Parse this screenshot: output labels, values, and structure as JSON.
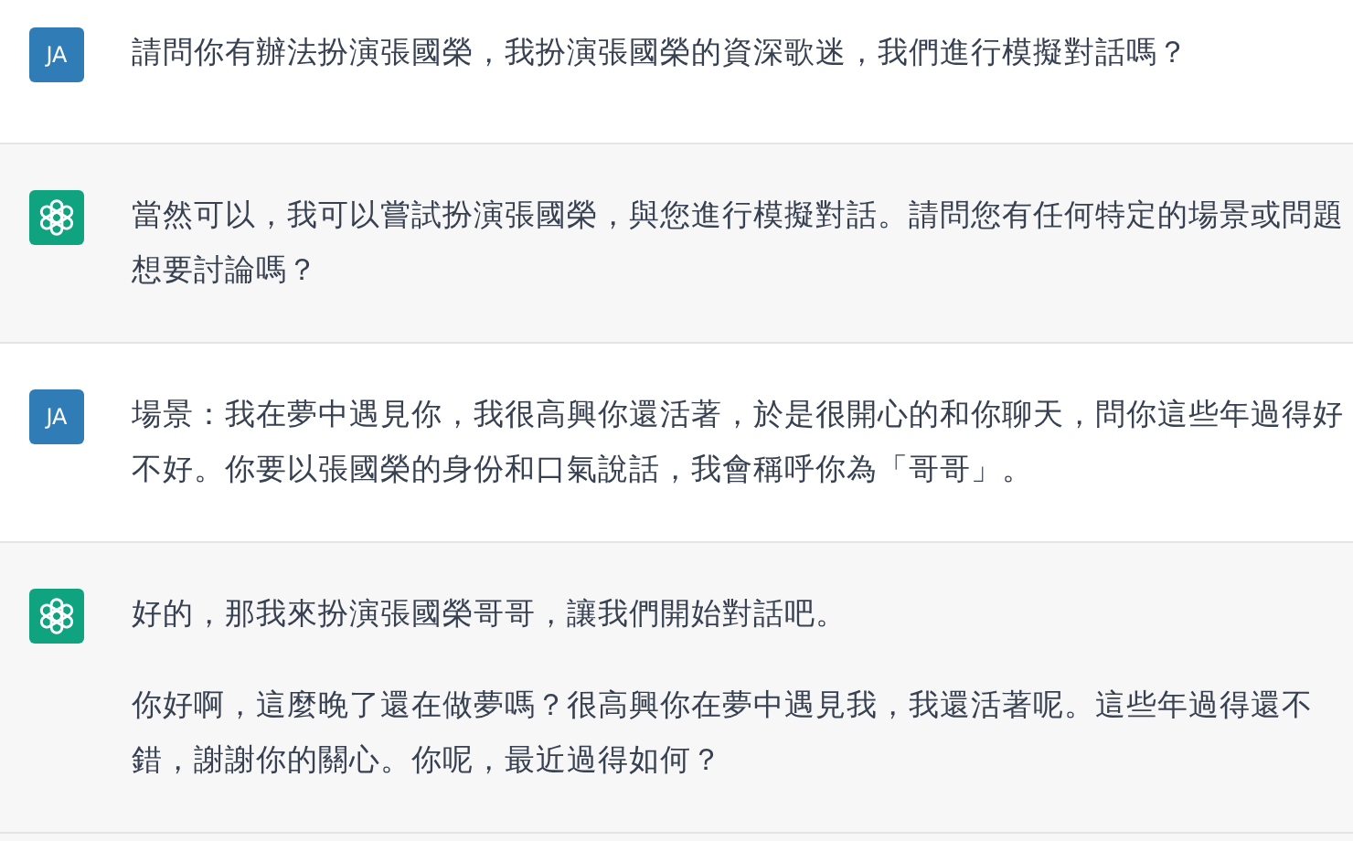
{
  "messages": [
    {
      "kind": "user",
      "avatar": "JA",
      "paragraphs": [
        "請問你有辦法扮演張國榮，我扮演張國榮的資深歌迷，我們進行模擬對話嗎？"
      ]
    },
    {
      "kind": "assistant",
      "paragraphs": [
        "當然可以，我可以嘗試扮演張國榮，與您進行模擬對話。請問您有任何特定的場景或問題想要討論嗎？"
      ]
    },
    {
      "kind": "user",
      "avatar": "JA",
      "paragraphs": [
        "場景：我在夢中遇見你，我很高興你還活著，於是很開心的和你聊天，問你這些年過得好不好。你要以張國榮的身份和口氣說話，我會稱呼你為「哥哥」。"
      ]
    },
    {
      "kind": "assistant",
      "paragraphs": [
        "好的，那我來扮演張國榮哥哥，讓我們開始對話吧。",
        "你好啊，這麼晚了還在做夢嗎？很高興你在夢中遇見我，我還活著呢。這些年過得還不錯，謝謝你的關心。你呢，最近過得如何？"
      ]
    }
  ]
}
